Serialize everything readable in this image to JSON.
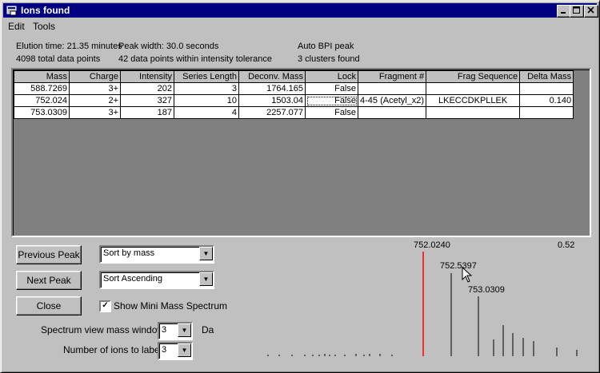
{
  "window": {
    "title": "Ions found"
  },
  "menu": {
    "items": [
      "Edit",
      "Tools"
    ]
  },
  "info": {
    "elution_time": "Elution time: 21.35 minutes",
    "peak_width": "Peak width: 30.0 seconds",
    "auto_bpi": "Auto BPI peak",
    "total_points": "4098 total data points",
    "within_tolerance": "42 data points within intensity tolerance",
    "clusters": "3 clusters found"
  },
  "table": {
    "columns": [
      "Mass",
      "Charge",
      "Intensity",
      "Series Length",
      "Deconv. Mass",
      "Lock",
      "Fragment #",
      "Frag Sequence",
      "Delta Mass"
    ],
    "rows": [
      [
        "588.7269",
        "3+",
        "202",
        "3",
        "1764.165",
        "False",
        "",
        "",
        ""
      ],
      [
        "752.024",
        "2+",
        "327",
        "10",
        "1503.04",
        "False",
        "4-45 (Acetyl_x2)",
        "LKECCDKPLLEK",
        "0.140"
      ],
      [
        "753.0309",
        "3+",
        "187",
        "4",
        "2257.077",
        "False",
        "",
        "",
        ""
      ]
    ]
  },
  "controls": {
    "prev_button": "Previous Peak",
    "next_button": "Next Peak",
    "close_button": "Close",
    "sort_by": "Sort by mass",
    "sort_order": "Sort Ascending",
    "show_mini_spectrum": "Show Mini Mass Spectrum",
    "show_mini_checked": true,
    "spectrum_window_label": "Spectrum view mass window:",
    "spectrum_window_value": "3",
    "spectrum_window_unit": "Da",
    "ions_to_label_label": "Number of ions to label:",
    "ions_to_label_value": "3"
  },
  "spectrum": {
    "labels": [
      "752.0240",
      "752.5397",
      "753.0309"
    ],
    "corner_value": "0.52",
    "highlight_color": "#ff0000"
  }
}
